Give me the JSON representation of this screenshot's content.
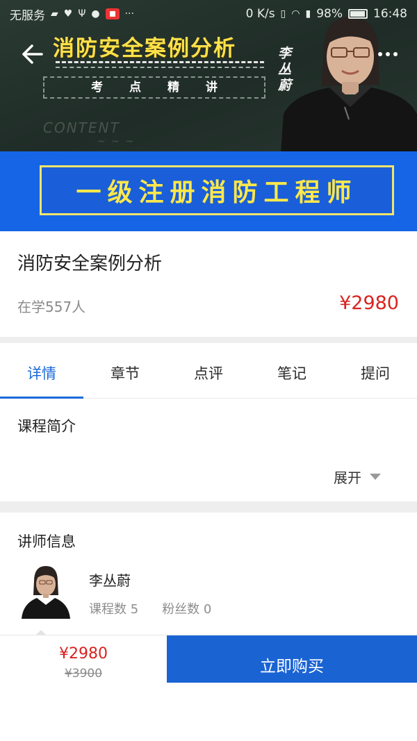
{
  "status_bar": {
    "carrier": "无服务",
    "speed": "0 K/s",
    "battery": "98%",
    "time": "16:48"
  },
  "banner": {
    "course_title": "消防安全案例分析",
    "subtitle": "考 点 精 讲",
    "signature": "李丛蔚",
    "chalk_text": "CONTENT",
    "exam_title": "一级注册消防工程师"
  },
  "course": {
    "title": "消防安全案例分析",
    "learners": "在学557人",
    "price": "¥2980"
  },
  "tabs": [
    {
      "label": "详情",
      "active": true
    },
    {
      "label": "章节",
      "active": false
    },
    {
      "label": "点评",
      "active": false
    },
    {
      "label": "笔记",
      "active": false
    },
    {
      "label": "提问",
      "active": false
    }
  ],
  "intro": {
    "heading": "课程简介",
    "expand_label": "展开"
  },
  "instructor": {
    "heading": "讲师信息",
    "name": "李丛蔚",
    "courses": "课程数 5",
    "fans": "粉丝数 0"
  },
  "bottom_bar": {
    "price": "¥2980",
    "original_price": "¥3900",
    "buy_label": "立即购买"
  },
  "colors": {
    "accent_blue": "#1a6ad8",
    "buy_button": "#1a63d3",
    "price_red": "#d9231f",
    "banner_blue": "#1565e6",
    "banner_yellow": "#ffe84a"
  },
  "icons": [
    "back-arrow-icon",
    "more-dots-icon",
    "expand-triangle-icon",
    "wifi-icon",
    "battery-icon",
    "record-icon"
  ]
}
